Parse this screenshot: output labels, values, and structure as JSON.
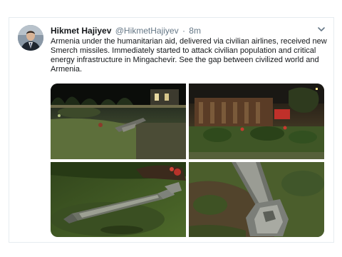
{
  "tweet": {
    "author": {
      "display_name": "Hikmet Hajiyev",
      "handle": "@HikmetHajiyev",
      "separator": "·",
      "time": "8m"
    },
    "text": "Armenia under the humanitarian aid, delivered via civilian airlines, received new Smerch missiles. Immediately started to attack civilian population and critical energy infrastructure in Mingachevir. See the gap between civilized world and Armenia.",
    "icons": {
      "menu": "chevron-down-icon",
      "avatar": "avatar"
    },
    "colors": {
      "text": "#14171a",
      "secondary_text": "#657786",
      "border": "#e6ecf0"
    }
  }
}
